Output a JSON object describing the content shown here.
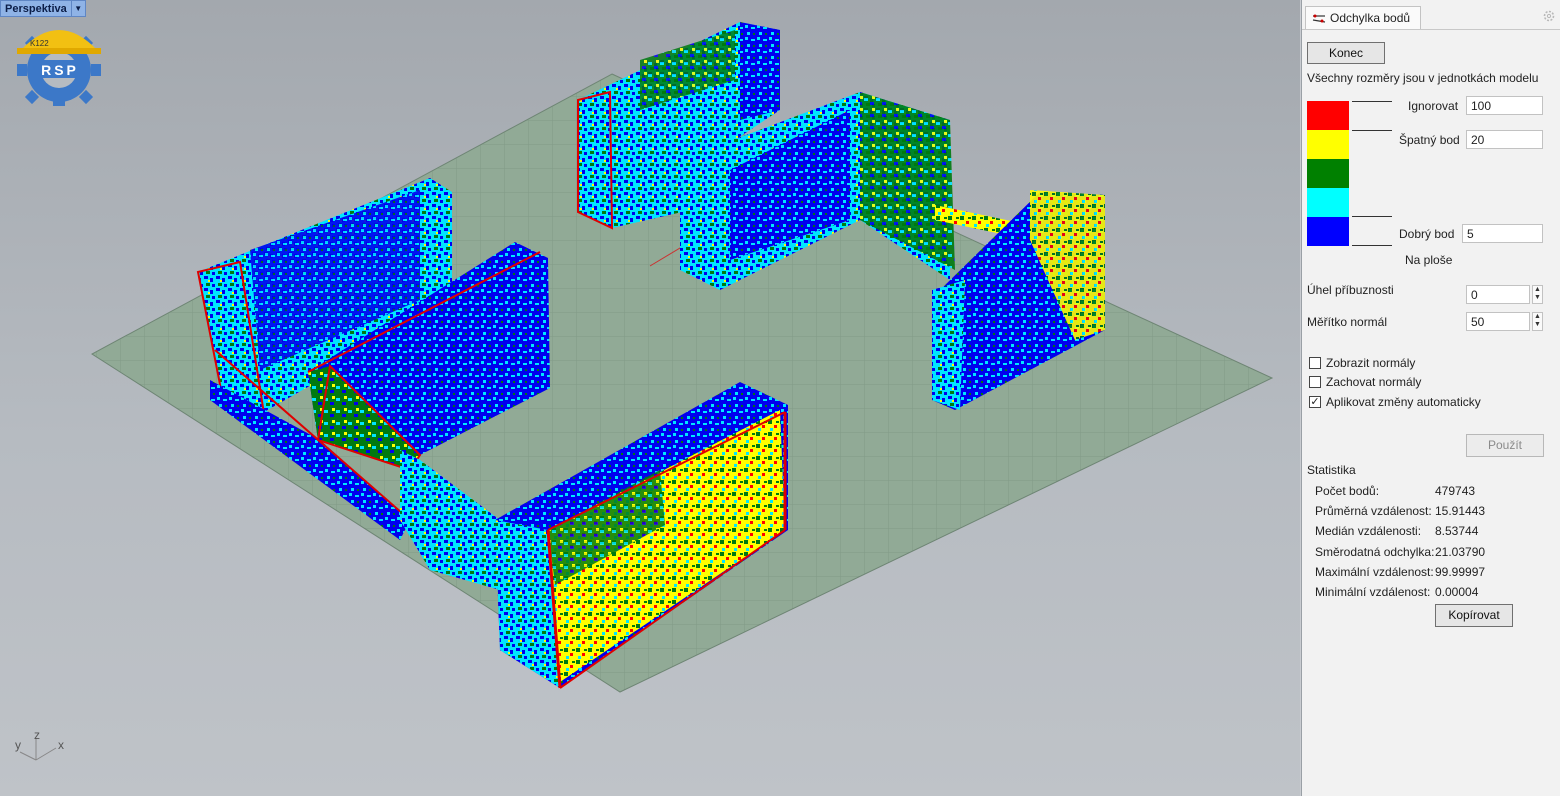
{
  "viewport": {
    "name": "Perspektiva",
    "logo": {
      "top_text": "K122",
      "text": "RSP"
    },
    "axes": {
      "x": "x",
      "y": "y",
      "z": "z"
    }
  },
  "panel": {
    "tab_title": "Odchylka bodů",
    "end_button": "Konec",
    "units_note": "Všechny rozměry jsou v jednotkách modelu",
    "legend": {
      "colors": [
        "#ff0000",
        "#ffff00",
        "#008000",
        "#00ffff",
        "#0000ff"
      ],
      "ignore_label": "Ignorovat",
      "ignore_value": "100",
      "bad_label": "Špatný bod",
      "bad_value": "20",
      "good_label": "Dobrý bod",
      "good_value": "5",
      "surface_label": "Na ploše"
    },
    "angle_label": "Úhel příbuznosti",
    "angle_value": "0",
    "normal_scale_label": "Měřítko normál",
    "normal_scale_value": "50",
    "checkboxes": [
      {
        "label": "Zobrazit normály",
        "checked": false
      },
      {
        "label": "Zachovat normály",
        "checked": false
      },
      {
        "label": "Aplikovat změny automaticky",
        "checked": true
      }
    ],
    "apply_button": "Použít",
    "stats_title": "Statistika",
    "stats": [
      {
        "label": "Počet bodů:",
        "value": "479743"
      },
      {
        "label": "Průměrná vzdálenost:",
        "value": "15.91443"
      },
      {
        "label": "Medián vzdálenosti:",
        "value": "8.53744"
      },
      {
        "label": "Směrodatná odchylka:",
        "value": "21.03790"
      },
      {
        "label": "Maximální vzdálenost:",
        "value": "99.99997"
      },
      {
        "label": "Minimální vzdálenost:",
        "value": "0.00004"
      }
    ],
    "copy_button": "Kopírovat"
  }
}
